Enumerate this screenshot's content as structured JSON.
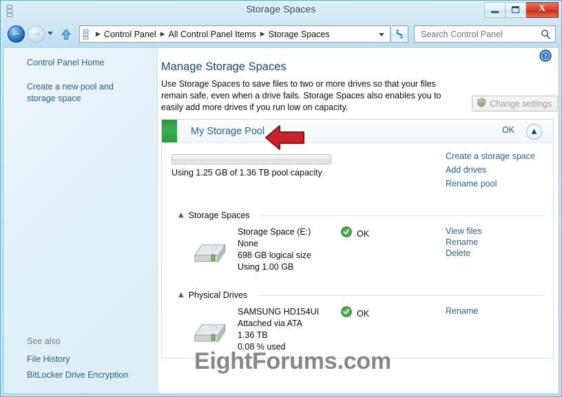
{
  "window": {
    "title": "Storage Spaces",
    "icon": "control-panel-icon",
    "minimize_label": "–",
    "maximize_label": "□",
    "close_label": "X"
  },
  "navbar": {
    "back_label": "←",
    "forward_label": "→",
    "history_caret": "▼",
    "up_label": "⇧",
    "breadcrumbs": [
      "Control Panel",
      "All Control Panel Items",
      "Storage Spaces"
    ],
    "separator": "▶",
    "address_caret": "▼",
    "refresh_label": "↻",
    "search": {
      "placeholder": "Search Control Panel",
      "value": ""
    }
  },
  "sidebar": {
    "home_link": "Control Panel Home",
    "create_link": "Create a new pool and storage space",
    "see_also_label": "See also",
    "see_also_links": [
      "File History",
      "BitLocker Drive Encryption"
    ]
  },
  "content": {
    "help_label": "?",
    "title": "Manage Storage Spaces",
    "description": "Use Storage Spaces to save files to two or more drives so that your files remain safe, even when a drive fails. Storage Spaces also enables you to easily add more drives if you run low on capacity.",
    "change_settings_label": "Change settings",
    "change_settings_icon": "uac-shield-icon",
    "pool": {
      "name": "My Storage Pool",
      "status": "OK",
      "status_color": "#36a64a",
      "collapse_icon": "chevron-up-icon",
      "capacity_text": "Using 1.25 GB of 1.36 TB pool capacity",
      "capacity_percent": 0.08,
      "links": [
        "Create a storage space",
        "Add drives",
        "Rename pool"
      ]
    },
    "sections": [
      {
        "title": "Storage Spaces",
        "chevron": "▲",
        "rows": [
          {
            "icon": "hard-drive-icon",
            "lines": [
              "Storage Space (E:)",
              "None",
              "698 GB logical size",
              "Using 1.00 GB"
            ],
            "status": "OK",
            "status_icon": "green-check-icon",
            "actions": [
              "View files",
              "Rename",
              "Delete"
            ]
          }
        ]
      },
      {
        "title": "Physical Drives",
        "chevron": "▲",
        "rows": [
          {
            "icon": "hard-drive-icon",
            "lines": [
              "SAMSUNG HD154UI",
              "Attached via ATA",
              "1.36 TB",
              "0.08 % used"
            ],
            "status": "OK",
            "status_icon": "green-check-icon",
            "actions": [
              "Rename"
            ]
          }
        ]
      }
    ]
  },
  "annotation": {
    "arrow_name": "red-callout-arrow",
    "arrow_color": "#cc2229",
    "points_to": "My Storage Pool"
  },
  "watermark": {
    "text": "EightForums.com",
    "color": "#7d7d7d"
  }
}
